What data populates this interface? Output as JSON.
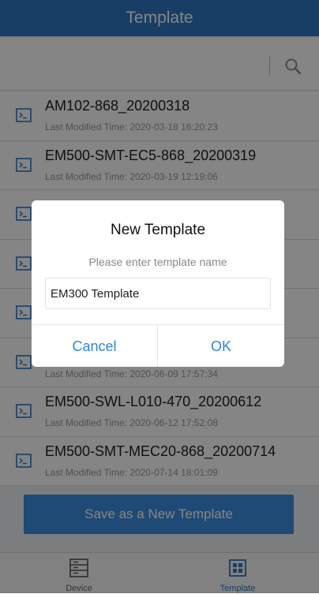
{
  "header": {
    "title": "Template"
  },
  "search": {
    "placeholder": ""
  },
  "templates": [
    {
      "name": "AM102-868_20200318",
      "time": "Last Modified Time: 2020-03-18 16:20:23"
    },
    {
      "name": "EM500-SMT-EC5-868_20200319",
      "time": "Last Modified Time: 2020-03-19 12:19:06"
    },
    {
      "name": "",
      "time": ""
    },
    {
      "name": "",
      "time": ""
    },
    {
      "name": "",
      "time": ""
    },
    {
      "name": "",
      "time": "Last Modified Time: 2020-06-09 17:57:34"
    },
    {
      "name": "EM500-SWL-L010-470_20200612",
      "time": "Last Modified Time: 2020-06-12 17:52:08"
    },
    {
      "name": "EM500-SMT-MEC20-868_20200714",
      "time": "Last Modified Time: 2020-07-14 18:01:09"
    }
  ],
  "save_button": {
    "label": "Save as a  New Template"
  },
  "bottom_nav": {
    "device_label": "Device",
    "template_label": "Template"
  },
  "dialog": {
    "title": "New Template",
    "message": "Please enter template name",
    "input_value": "EM300 Template",
    "cancel_label": "Cancel",
    "ok_label": "OK"
  },
  "colors": {
    "header": "#2f78c4",
    "accent": "#2f86d6",
    "save_button": "#3d8fe0"
  }
}
